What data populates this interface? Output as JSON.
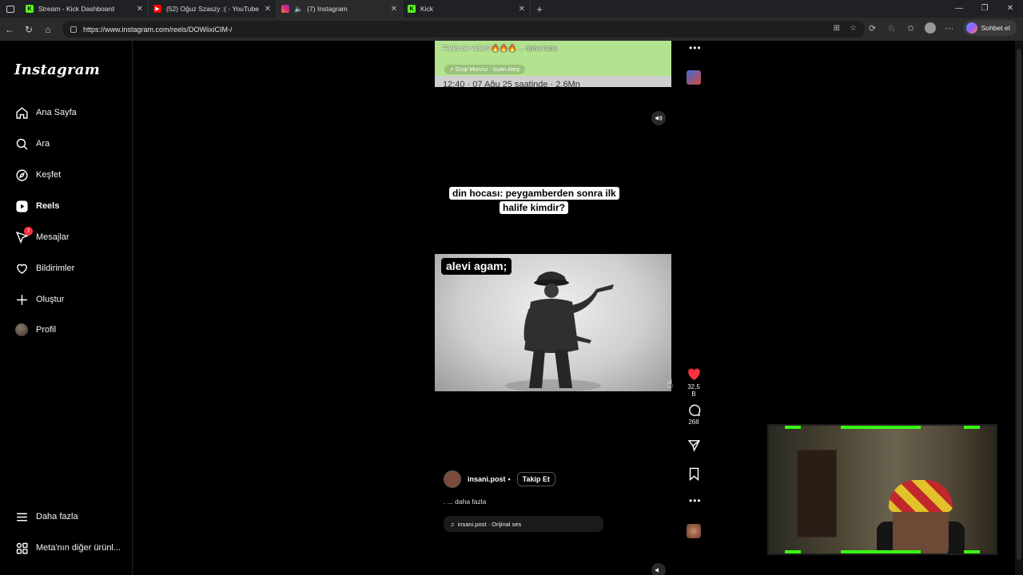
{
  "browser": {
    "tabs": [
      {
        "title": "Stream - Kick Dashboard",
        "favicon": "kick-icon",
        "color": "#53fc18",
        "active": false
      },
      {
        "title": "(52) Oğuz Szaszy :( - YouTube",
        "favicon": "youtube-icon",
        "color": "#ff0000",
        "active": false
      },
      {
        "title": "(7) Instagram",
        "favicon": "instagram-icon",
        "color": "#e1306c",
        "active": true
      },
      {
        "title": "Kick",
        "favicon": "kick-icon",
        "color": "#53fc18",
        "active": false
      }
    ],
    "url": "https://www.instagram.com/reels/DOWiixiCIM-/",
    "chat_button": "Sohbet et"
  },
  "sidebar": {
    "logo": "Instagram",
    "items": [
      {
        "label": "Ana Sayfa",
        "icon": "home-icon"
      },
      {
        "label": "Ara",
        "icon": "search-icon"
      },
      {
        "label": "Keşfet",
        "icon": "compass-icon"
      },
      {
        "label": "Reels",
        "icon": "reels-icon",
        "active": true
      },
      {
        "label": "Mesajlar",
        "icon": "messenger-icon",
        "badge": "7"
      },
      {
        "label": "Bildirimler",
        "icon": "heart-icon"
      },
      {
        "label": "Oluştur",
        "icon": "plus-icon"
      },
      {
        "label": "Profil",
        "icon": "avatar-icon"
      }
    ],
    "more": "Daha fazla",
    "meta": "Meta'nın diğer ürünl..."
  },
  "prev_reel": {
    "caption": "Farklı bir video?🔥🔥🔥",
    "more": "... daha fazla",
    "music": "↗ Grup Munzur · İsyan Ateşi",
    "stamp": "12:40 · 07 Ağu 25 saatinde · 2,6Mn"
  },
  "reel": {
    "overlay_text": "din hocası: peygamberden sonra ilk halife kimdir?",
    "meme_label": "alevi agam;",
    "likes": "32,5 B",
    "comments": "268",
    "author": "insani.post",
    "follow": "Takip Et",
    "description": ". ... daha fazla",
    "audio": "insani.post · Orijinal ses"
  },
  "colors": {
    "like": "#ff3040",
    "accent_webcam": "#39ff14"
  }
}
